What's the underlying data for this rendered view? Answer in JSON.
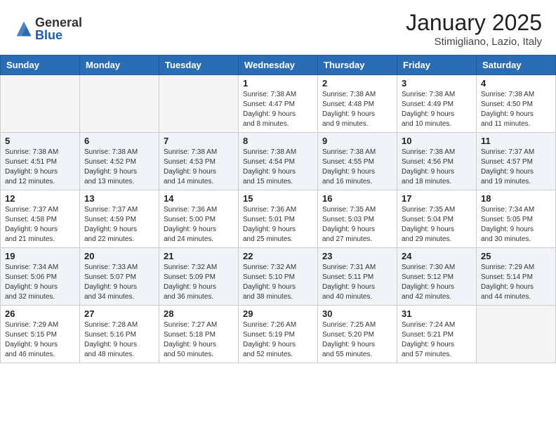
{
  "header": {
    "logo_general": "General",
    "logo_blue": "Blue",
    "month": "January 2025",
    "location": "Stimigliano, Lazio, Italy"
  },
  "weekdays": [
    "Sunday",
    "Monday",
    "Tuesday",
    "Wednesday",
    "Thursday",
    "Friday",
    "Saturday"
  ],
  "weeks": [
    [
      {
        "day": "",
        "sunrise": "",
        "sunset": "",
        "daylight": "",
        "empty": true
      },
      {
        "day": "",
        "sunrise": "",
        "sunset": "",
        "daylight": "",
        "empty": true
      },
      {
        "day": "",
        "sunrise": "",
        "sunset": "",
        "daylight": "",
        "empty": true
      },
      {
        "day": "1",
        "sunrise": "Sunrise: 7:38 AM",
        "sunset": "Sunset: 4:47 PM",
        "daylight": "Daylight: 9 hours and 8 minutes."
      },
      {
        "day": "2",
        "sunrise": "Sunrise: 7:38 AM",
        "sunset": "Sunset: 4:48 PM",
        "daylight": "Daylight: 9 hours and 9 minutes."
      },
      {
        "day": "3",
        "sunrise": "Sunrise: 7:38 AM",
        "sunset": "Sunset: 4:49 PM",
        "daylight": "Daylight: 9 hours and 10 minutes."
      },
      {
        "day": "4",
        "sunrise": "Sunrise: 7:38 AM",
        "sunset": "Sunset: 4:50 PM",
        "daylight": "Daylight: 9 hours and 11 minutes."
      }
    ],
    [
      {
        "day": "5",
        "sunrise": "Sunrise: 7:38 AM",
        "sunset": "Sunset: 4:51 PM",
        "daylight": "Daylight: 9 hours and 12 minutes."
      },
      {
        "day": "6",
        "sunrise": "Sunrise: 7:38 AM",
        "sunset": "Sunset: 4:52 PM",
        "daylight": "Daylight: 9 hours and 13 minutes."
      },
      {
        "day": "7",
        "sunrise": "Sunrise: 7:38 AM",
        "sunset": "Sunset: 4:53 PM",
        "daylight": "Daylight: 9 hours and 14 minutes."
      },
      {
        "day": "8",
        "sunrise": "Sunrise: 7:38 AM",
        "sunset": "Sunset: 4:54 PM",
        "daylight": "Daylight: 9 hours and 15 minutes."
      },
      {
        "day": "9",
        "sunrise": "Sunrise: 7:38 AM",
        "sunset": "Sunset: 4:55 PM",
        "daylight": "Daylight: 9 hours and 16 minutes."
      },
      {
        "day": "10",
        "sunrise": "Sunrise: 7:38 AM",
        "sunset": "Sunset: 4:56 PM",
        "daylight": "Daylight: 9 hours and 18 minutes."
      },
      {
        "day": "11",
        "sunrise": "Sunrise: 7:37 AM",
        "sunset": "Sunset: 4:57 PM",
        "daylight": "Daylight: 9 hours and 19 minutes."
      }
    ],
    [
      {
        "day": "12",
        "sunrise": "Sunrise: 7:37 AM",
        "sunset": "Sunset: 4:58 PM",
        "daylight": "Daylight: 9 hours and 21 minutes."
      },
      {
        "day": "13",
        "sunrise": "Sunrise: 7:37 AM",
        "sunset": "Sunset: 4:59 PM",
        "daylight": "Daylight: 9 hours and 22 minutes."
      },
      {
        "day": "14",
        "sunrise": "Sunrise: 7:36 AM",
        "sunset": "Sunset: 5:00 PM",
        "daylight": "Daylight: 9 hours and 24 minutes."
      },
      {
        "day": "15",
        "sunrise": "Sunrise: 7:36 AM",
        "sunset": "Sunset: 5:01 PM",
        "daylight": "Daylight: 9 hours and 25 minutes."
      },
      {
        "day": "16",
        "sunrise": "Sunrise: 7:35 AM",
        "sunset": "Sunset: 5:03 PM",
        "daylight": "Daylight: 9 hours and 27 minutes."
      },
      {
        "day": "17",
        "sunrise": "Sunrise: 7:35 AM",
        "sunset": "Sunset: 5:04 PM",
        "daylight": "Daylight: 9 hours and 29 minutes."
      },
      {
        "day": "18",
        "sunrise": "Sunrise: 7:34 AM",
        "sunset": "Sunset: 5:05 PM",
        "daylight": "Daylight: 9 hours and 30 minutes."
      }
    ],
    [
      {
        "day": "19",
        "sunrise": "Sunrise: 7:34 AM",
        "sunset": "Sunset: 5:06 PM",
        "daylight": "Daylight: 9 hours and 32 minutes."
      },
      {
        "day": "20",
        "sunrise": "Sunrise: 7:33 AM",
        "sunset": "Sunset: 5:07 PM",
        "daylight": "Daylight: 9 hours and 34 minutes."
      },
      {
        "day": "21",
        "sunrise": "Sunrise: 7:32 AM",
        "sunset": "Sunset: 5:09 PM",
        "daylight": "Daylight: 9 hours and 36 minutes."
      },
      {
        "day": "22",
        "sunrise": "Sunrise: 7:32 AM",
        "sunset": "Sunset: 5:10 PM",
        "daylight": "Daylight: 9 hours and 38 minutes."
      },
      {
        "day": "23",
        "sunrise": "Sunrise: 7:31 AM",
        "sunset": "Sunset: 5:11 PM",
        "daylight": "Daylight: 9 hours and 40 minutes."
      },
      {
        "day": "24",
        "sunrise": "Sunrise: 7:30 AM",
        "sunset": "Sunset: 5:12 PM",
        "daylight": "Daylight: 9 hours and 42 minutes."
      },
      {
        "day": "25",
        "sunrise": "Sunrise: 7:29 AM",
        "sunset": "Sunset: 5:14 PM",
        "daylight": "Daylight: 9 hours and 44 minutes."
      }
    ],
    [
      {
        "day": "26",
        "sunrise": "Sunrise: 7:29 AM",
        "sunset": "Sunset: 5:15 PM",
        "daylight": "Daylight: 9 hours and 46 minutes."
      },
      {
        "day": "27",
        "sunrise": "Sunrise: 7:28 AM",
        "sunset": "Sunset: 5:16 PM",
        "daylight": "Daylight: 9 hours and 48 minutes."
      },
      {
        "day": "28",
        "sunrise": "Sunrise: 7:27 AM",
        "sunset": "Sunset: 5:18 PM",
        "daylight": "Daylight: 9 hours and 50 minutes."
      },
      {
        "day": "29",
        "sunrise": "Sunrise: 7:26 AM",
        "sunset": "Sunset: 5:19 PM",
        "daylight": "Daylight: 9 hours and 52 minutes."
      },
      {
        "day": "30",
        "sunrise": "Sunrise: 7:25 AM",
        "sunset": "Sunset: 5:20 PM",
        "daylight": "Daylight: 9 hours and 55 minutes."
      },
      {
        "day": "31",
        "sunrise": "Sunrise: 7:24 AM",
        "sunset": "Sunset: 5:21 PM",
        "daylight": "Daylight: 9 hours and 57 minutes."
      },
      {
        "day": "",
        "sunrise": "",
        "sunset": "",
        "daylight": "",
        "empty": true
      }
    ]
  ]
}
